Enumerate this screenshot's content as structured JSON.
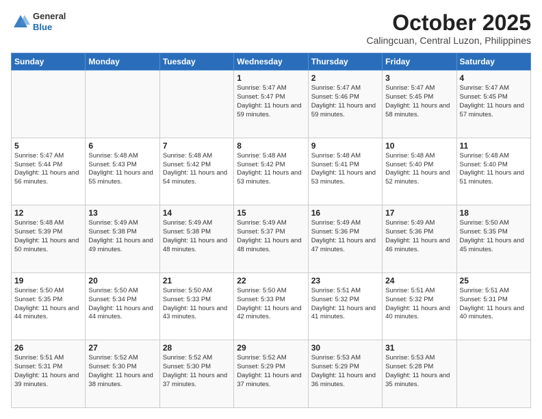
{
  "header": {
    "logo": {
      "general": "General",
      "blue": "Blue"
    },
    "title": "October 2025",
    "location": "Calingcuan, Central Luzon, Philippines"
  },
  "calendar": {
    "days_of_week": [
      "Sunday",
      "Monday",
      "Tuesday",
      "Wednesday",
      "Thursday",
      "Friday",
      "Saturday"
    ],
    "weeks": [
      [
        {
          "day": "",
          "info": ""
        },
        {
          "day": "",
          "info": ""
        },
        {
          "day": "",
          "info": ""
        },
        {
          "day": "1",
          "info": "Sunrise: 5:47 AM\nSunset: 5:47 PM\nDaylight: 11 hours\nand 59 minutes."
        },
        {
          "day": "2",
          "info": "Sunrise: 5:47 AM\nSunset: 5:46 PM\nDaylight: 11 hours\nand 59 minutes."
        },
        {
          "day": "3",
          "info": "Sunrise: 5:47 AM\nSunset: 5:45 PM\nDaylight: 11 hours\nand 58 minutes."
        },
        {
          "day": "4",
          "info": "Sunrise: 5:47 AM\nSunset: 5:45 PM\nDaylight: 11 hours\nand 57 minutes."
        }
      ],
      [
        {
          "day": "5",
          "info": "Sunrise: 5:47 AM\nSunset: 5:44 PM\nDaylight: 11 hours\nand 56 minutes."
        },
        {
          "day": "6",
          "info": "Sunrise: 5:48 AM\nSunset: 5:43 PM\nDaylight: 11 hours\nand 55 minutes."
        },
        {
          "day": "7",
          "info": "Sunrise: 5:48 AM\nSunset: 5:42 PM\nDaylight: 11 hours\nand 54 minutes."
        },
        {
          "day": "8",
          "info": "Sunrise: 5:48 AM\nSunset: 5:42 PM\nDaylight: 11 hours\nand 53 minutes."
        },
        {
          "day": "9",
          "info": "Sunrise: 5:48 AM\nSunset: 5:41 PM\nDaylight: 11 hours\nand 53 minutes."
        },
        {
          "day": "10",
          "info": "Sunrise: 5:48 AM\nSunset: 5:40 PM\nDaylight: 11 hours\nand 52 minutes."
        },
        {
          "day": "11",
          "info": "Sunrise: 5:48 AM\nSunset: 5:40 PM\nDaylight: 11 hours\nand 51 minutes."
        }
      ],
      [
        {
          "day": "12",
          "info": "Sunrise: 5:48 AM\nSunset: 5:39 PM\nDaylight: 11 hours\nand 50 minutes."
        },
        {
          "day": "13",
          "info": "Sunrise: 5:49 AM\nSunset: 5:38 PM\nDaylight: 11 hours\nand 49 minutes."
        },
        {
          "day": "14",
          "info": "Sunrise: 5:49 AM\nSunset: 5:38 PM\nDaylight: 11 hours\nand 48 minutes."
        },
        {
          "day": "15",
          "info": "Sunrise: 5:49 AM\nSunset: 5:37 PM\nDaylight: 11 hours\nand 48 minutes."
        },
        {
          "day": "16",
          "info": "Sunrise: 5:49 AM\nSunset: 5:36 PM\nDaylight: 11 hours\nand 47 minutes."
        },
        {
          "day": "17",
          "info": "Sunrise: 5:49 AM\nSunset: 5:36 PM\nDaylight: 11 hours\nand 46 minutes."
        },
        {
          "day": "18",
          "info": "Sunrise: 5:50 AM\nSunset: 5:35 PM\nDaylight: 11 hours\nand 45 minutes."
        }
      ],
      [
        {
          "day": "19",
          "info": "Sunrise: 5:50 AM\nSunset: 5:35 PM\nDaylight: 11 hours\nand 44 minutes."
        },
        {
          "day": "20",
          "info": "Sunrise: 5:50 AM\nSunset: 5:34 PM\nDaylight: 11 hours\nand 44 minutes."
        },
        {
          "day": "21",
          "info": "Sunrise: 5:50 AM\nSunset: 5:33 PM\nDaylight: 11 hours\nand 43 minutes."
        },
        {
          "day": "22",
          "info": "Sunrise: 5:50 AM\nSunset: 5:33 PM\nDaylight: 11 hours\nand 42 minutes."
        },
        {
          "day": "23",
          "info": "Sunrise: 5:51 AM\nSunset: 5:32 PM\nDaylight: 11 hours\nand 41 minutes."
        },
        {
          "day": "24",
          "info": "Sunrise: 5:51 AM\nSunset: 5:32 PM\nDaylight: 11 hours\nand 40 minutes."
        },
        {
          "day": "25",
          "info": "Sunrise: 5:51 AM\nSunset: 5:31 PM\nDaylight: 11 hours\nand 40 minutes."
        }
      ],
      [
        {
          "day": "26",
          "info": "Sunrise: 5:51 AM\nSunset: 5:31 PM\nDaylight: 11 hours\nand 39 minutes."
        },
        {
          "day": "27",
          "info": "Sunrise: 5:52 AM\nSunset: 5:30 PM\nDaylight: 11 hours\nand 38 minutes."
        },
        {
          "day": "28",
          "info": "Sunrise: 5:52 AM\nSunset: 5:30 PM\nDaylight: 11 hours\nand 37 minutes."
        },
        {
          "day": "29",
          "info": "Sunrise: 5:52 AM\nSunset: 5:29 PM\nDaylight: 11 hours\nand 37 minutes."
        },
        {
          "day": "30",
          "info": "Sunrise: 5:53 AM\nSunset: 5:29 PM\nDaylight: 11 hours\nand 36 minutes."
        },
        {
          "day": "31",
          "info": "Sunrise: 5:53 AM\nSunset: 5:28 PM\nDaylight: 11 hours\nand 35 minutes."
        },
        {
          "day": "",
          "info": ""
        }
      ]
    ]
  }
}
